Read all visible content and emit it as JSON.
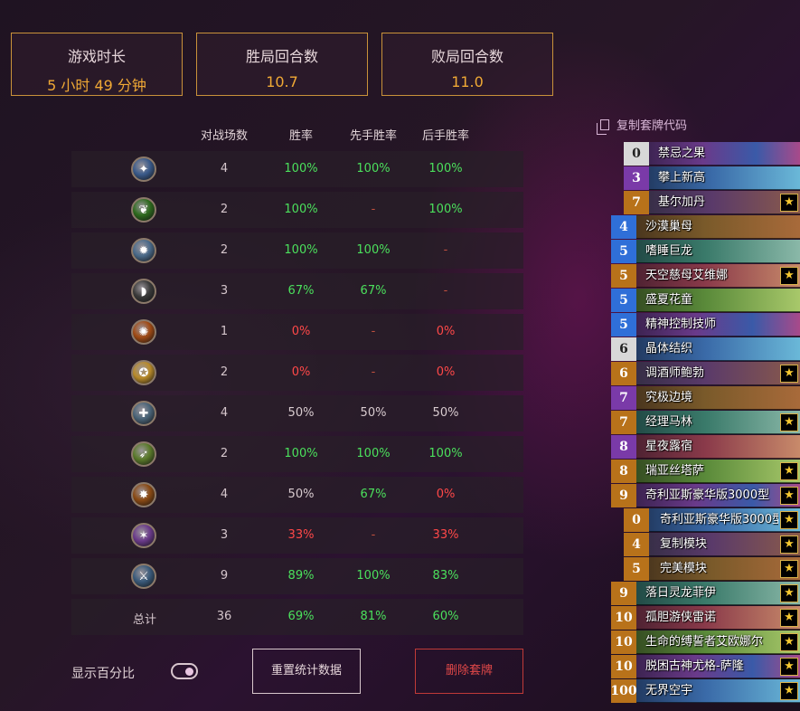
{
  "summary": {
    "play_time_label": "游戏时长",
    "play_time_value": "5 小时 49 分钟",
    "win_turns_label": "胜局回合数",
    "win_turns_value": "10.7",
    "loss_turns_label": "败局回合数",
    "loss_turns_value": "11.0"
  },
  "table": {
    "headers": [
      "对战场数",
      "胜率",
      "先手胜率",
      "后手胜率"
    ],
    "rows": [
      {
        "icon": "mage-class-icon",
        "glyph": "✦",
        "color": "#3a5a8a",
        "games": "4",
        "wr": "100%",
        "first": "100%",
        "second": "100%"
      },
      {
        "icon": "druid-class-icon",
        "glyph": "❦",
        "color": "#2e6a1e",
        "games": "2",
        "wr": "100%",
        "first": "-",
        "second": "100%"
      },
      {
        "icon": "shaman-class-icon",
        "glyph": "✹",
        "color": "#4a6a8a",
        "games": "2",
        "wr": "100%",
        "first": "100%",
        "second": "-"
      },
      {
        "icon": "rogue-class-icon",
        "glyph": "◗",
        "color": "#3a3a3a",
        "games": "3",
        "wr": "67%",
        "first": "67%",
        "second": "-"
      },
      {
        "icon": "warlock-class-icon",
        "glyph": "✺",
        "color": "#a04a14",
        "games": "1",
        "wr": "0%",
        "first": "-",
        "second": "0%"
      },
      {
        "icon": "paladin-class-icon",
        "glyph": "✪",
        "color": "#b88a2a",
        "games": "2",
        "wr": "0%",
        "first": "-",
        "second": "0%"
      },
      {
        "icon": "priest-class-icon",
        "glyph": "✚",
        "color": "#4a6478",
        "games": "4",
        "wr": "50%",
        "first": "50%",
        "second": "50%"
      },
      {
        "icon": "hunter-class-icon",
        "glyph": "➶",
        "color": "#5a7a2a",
        "games": "2",
        "wr": "100%",
        "first": "100%",
        "second": "100%"
      },
      {
        "icon": "warrior-class-icon",
        "glyph": "✸",
        "color": "#8a4a14",
        "games": "4",
        "wr": "50%",
        "first": "67%",
        "second": "0%"
      },
      {
        "icon": "demon-hunter-class-icon",
        "glyph": "✶",
        "color": "#6a3a8a",
        "games": "3",
        "wr": "33%",
        "first": "-",
        "second": "33%"
      },
      {
        "icon": "death-knight-class-icon",
        "glyph": "⚔",
        "color": "#3a5a7a",
        "games": "9",
        "wr": "89%",
        "first": "100%",
        "second": "83%"
      }
    ],
    "total": {
      "label": "总计",
      "games": "36",
      "wr": "69%",
      "first": "81%",
      "second": "60%"
    }
  },
  "controls": {
    "show_percent_label": "显示百分比",
    "reset_label": "重置统计数据",
    "delete_label": "删除套牌"
  },
  "deck": {
    "copy_code_label": "复制套牌代码",
    "cards": [
      {
        "cost": "0",
        "name": "禁忌之果",
        "rarity": "common",
        "star": false,
        "indent": true
      },
      {
        "cost": "3",
        "name": "攀上新高",
        "rarity": "epic",
        "star": false,
        "indent": true
      },
      {
        "cost": "7",
        "name": "基尔加丹",
        "rarity": "legendary",
        "star": true,
        "indent": true
      },
      {
        "cost": "4",
        "name": "沙漠巢母",
        "rarity": "rare",
        "star": false,
        "indent": false
      },
      {
        "cost": "5",
        "name": "嗜睡巨龙",
        "rarity": "rare",
        "star": false,
        "indent": false
      },
      {
        "cost": "5",
        "name": "天空慈母艾维娜",
        "rarity": "legendary",
        "star": true,
        "indent": false
      },
      {
        "cost": "5",
        "name": "盛夏花童",
        "rarity": "rare",
        "star": false,
        "indent": false
      },
      {
        "cost": "5",
        "name": "精神控制技师",
        "rarity": "rare",
        "star": false,
        "indent": false
      },
      {
        "cost": "6",
        "name": "晶体结织",
        "rarity": "common",
        "star": false,
        "indent": false
      },
      {
        "cost": "6",
        "name": "调酒师鲍勃",
        "rarity": "legendary",
        "star": true,
        "indent": false
      },
      {
        "cost": "7",
        "name": "究极边境",
        "rarity": "epic",
        "star": false,
        "indent": false
      },
      {
        "cost": "7",
        "name": "经理马林",
        "rarity": "legendary",
        "star": true,
        "indent": false
      },
      {
        "cost": "8",
        "name": "星夜露宿",
        "rarity": "epic",
        "star": false,
        "indent": false
      },
      {
        "cost": "8",
        "name": "瑞亚丝塔萨",
        "rarity": "legendary",
        "star": true,
        "indent": false
      },
      {
        "cost": "9",
        "name": "奇利亚斯豪华版3000型",
        "rarity": "legendary",
        "star": true,
        "indent": false
      },
      {
        "cost": "0",
        "name": "奇利亚斯豪华版3000型",
        "rarity": "legendary",
        "star": true,
        "indent": true,
        "sub": true
      },
      {
        "cost": "4",
        "name": "复制模块",
        "rarity": "legendary",
        "star": true,
        "indent": true,
        "sub": true
      },
      {
        "cost": "5",
        "name": "完美模块",
        "rarity": "legendary",
        "star": true,
        "indent": true,
        "sub": true
      },
      {
        "cost": "9",
        "name": "落日灵龙菲伊",
        "rarity": "legendary",
        "star": true,
        "indent": false
      },
      {
        "cost": "10",
        "name": "孤胆游侠雷诺",
        "rarity": "legendary",
        "star": true,
        "indent": false
      },
      {
        "cost": "10",
        "name": "生命的缚誓者艾欧娜尔",
        "rarity": "legendary",
        "star": true,
        "indent": false
      },
      {
        "cost": "10",
        "name": "脱困古神尤格-萨隆",
        "rarity": "legendary",
        "star": true,
        "indent": false
      },
      {
        "cost": "100",
        "name": "无界空宇",
        "rarity": "legendary",
        "star": true,
        "indent": false
      }
    ]
  },
  "colors": {
    "accent": "#f0a935",
    "good": "#4be05c",
    "bad": "#ff4848",
    "rarity_common": "#d8d8d8",
    "rarity_rare": "#2f6fd8",
    "rarity_epic": "#7a3aa8",
    "rarity_legendary": "#b8721a"
  }
}
